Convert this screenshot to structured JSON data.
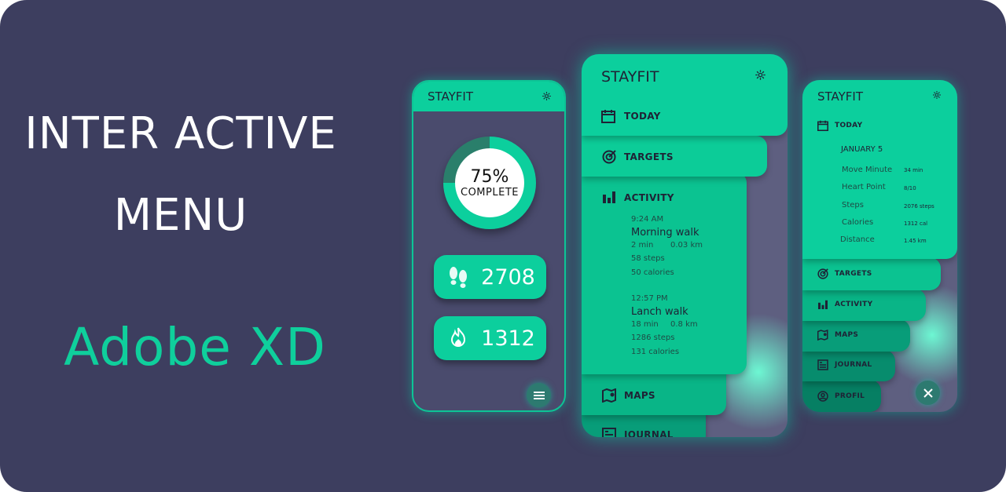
{
  "headline": {
    "line1": "INTER ACTIVE",
    "line2": "MENU",
    "brand": "Adobe XD"
  },
  "colors": {
    "background": "#3d3e5f",
    "accent": "#0ccf9d",
    "brand": "#0fcf9c"
  },
  "phone1": {
    "app_title": "STAYFIT",
    "progress": {
      "value": 0.75,
      "percent_label": "75%",
      "caption": "COMPLETE"
    },
    "steps": {
      "icon": "footprints-icon",
      "value": "2708"
    },
    "calories": {
      "icon": "flame-icon",
      "value": "1312"
    },
    "menu_button_icon": "hamburger-icon"
  },
  "phone2": {
    "app_title": "STAYFIT",
    "menu": {
      "today": "TODAY",
      "targets": "TARGETS",
      "activity": "ACTIVITY",
      "maps": "MAPS",
      "journal": "JOURNAL"
    },
    "activities": [
      {
        "time": "9:24 AM",
        "name": "Morning walk",
        "duration": "2 min",
        "distance": "0.03 km",
        "steps": "58 steps",
        "calories": "50 calories"
      },
      {
        "time": "12:57 PM",
        "name": "Lanch walk",
        "duration": "18 min",
        "distance": "0.8 km",
        "steps": "1286 steps",
        "calories": "131 calories"
      }
    ]
  },
  "phone3": {
    "app_title": "STAYFIT",
    "menu": {
      "today": "TODAY",
      "targets": "TARGETS",
      "activity": "ACTIVITY",
      "maps": "MAPS",
      "journal": "JOURNAL",
      "profil": "PROFIL"
    },
    "date": "JANUARY 5",
    "stats": [
      {
        "label": "Move Minute",
        "value": "34 min"
      },
      {
        "label": "Heart Point",
        "value": "8/10"
      },
      {
        "label": "Steps",
        "value": "2076 steps"
      },
      {
        "label": "Calories",
        "value": "1312 cal"
      },
      {
        "label": "Distance",
        "value": "1.45 km"
      }
    ],
    "close_icon": "close-icon"
  }
}
